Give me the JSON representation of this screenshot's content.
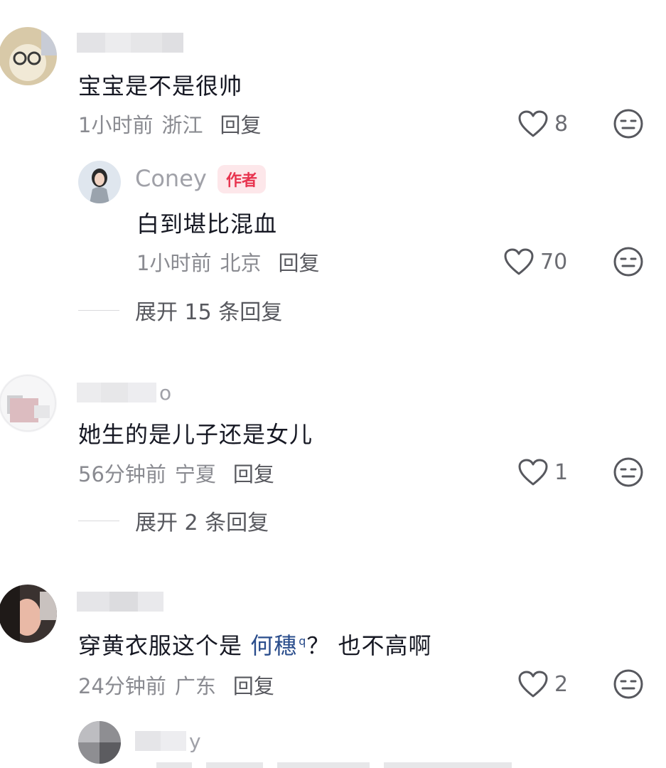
{
  "comments": [
    {
      "text": "宝宝是不是很帅",
      "time": "1小时前",
      "location": "浙江",
      "reply_label": "回复",
      "likes": "8",
      "author_reply": {
        "name": "Coney",
        "tag": "作者",
        "text": "白到堪比混血",
        "time": "1小时前",
        "location": "北京",
        "reply_label": "回复",
        "likes": "70"
      },
      "expand_label": "展开 15 条回复"
    },
    {
      "username_partial": "o",
      "text": "她生的是儿子还是女儿",
      "time": "56分钟前",
      "location": "宁夏",
      "reply_label": "回复",
      "likes": "1",
      "expand_label": "展开 2 条回复"
    },
    {
      "text_before": "穿黄衣服这个是 ",
      "mention": "何穗",
      "text_after": "？ 也不高啊",
      "time": "24分钟前",
      "location": "广东",
      "reply_label": "回复",
      "likes": "2"
    },
    {
      "username_partial": "y"
    }
  ],
  "colors": {
    "text": "#161823",
    "meta": "#8a8b91",
    "author_tag_bg": "#fde7ea",
    "author_tag_text": "#e8344f",
    "mention": "#2a4d8c"
  },
  "icons": {
    "like": "heart-outline-icon",
    "dislike": "neutral-face-icon",
    "search_hint": "search-icon"
  }
}
